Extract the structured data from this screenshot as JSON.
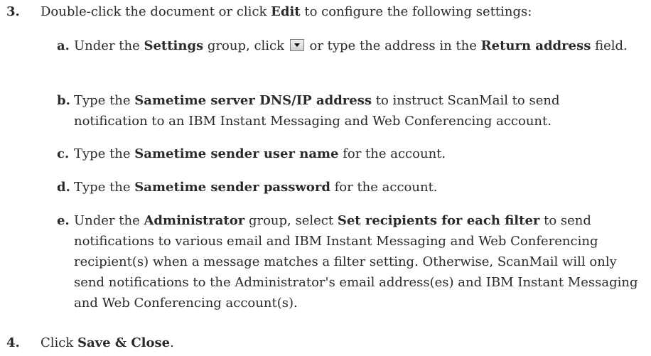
{
  "steps": {
    "s3": {
      "num": "3.",
      "t1": "Double-click the document or click ",
      "b1": "Edit",
      "t2": " to configure the following settings:"
    },
    "s4": {
      "num": "4.",
      "t1": "Click ",
      "b1": "Save & Close",
      "t2": "."
    }
  },
  "substeps": {
    "a": {
      "letter": "a.",
      "t1": "Under the ",
      "b1": "Settings",
      "t2": " group, click ",
      "icon": "dropdown-arrow-icon",
      "t3": " or type the address in the ",
      "b2": "Return address",
      "t4": " field."
    },
    "b": {
      "letter": "b.",
      "t1": "Type the ",
      "b1": "Sametime server DNS/IP address",
      "t2": " to instruct ScanMail to send notification to an IBM Instant Messaging and Web Conferencing account."
    },
    "c": {
      "letter": "c.",
      "t1": "Type the ",
      "b1": "Sametime sender user name",
      "t2": " for the account."
    },
    "d": {
      "letter": "d.",
      "t1": "Type the ",
      "b1": "Sametime sender password",
      "t2": " for the account."
    },
    "e": {
      "letter": "e.",
      "t1": "Under the ",
      "b1": "Administrator",
      "t2": " group, select ",
      "b2": "Set recipients for each filter",
      "t3": " to send notifications to various email and IBM Instant Messaging and Web Conferencing recipient(s) when a message matches a filter setting. Otherwise, ScanMail will only send notifications to the Administrator's email address(es) and IBM Instant Messaging and Web Conferencing account(s)."
    }
  }
}
